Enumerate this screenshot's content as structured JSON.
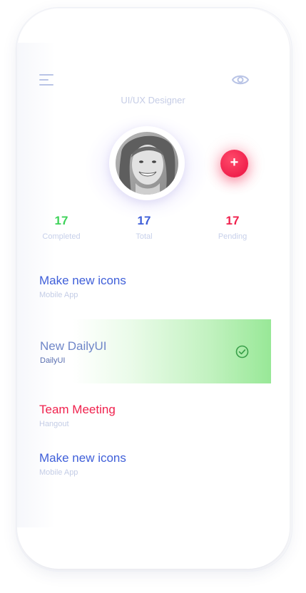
{
  "header": {
    "menu_icon": "menu-icon",
    "eye_icon": "eye-icon",
    "role": "UI/UX Designer"
  },
  "profile": {
    "avatar": "avatar",
    "add_button_label": "+"
  },
  "stats": [
    {
      "value": "17",
      "label": "Completed",
      "color": "#3fd35a"
    },
    {
      "value": "17",
      "label": "Total",
      "color": "#3f5fd9"
    },
    {
      "value": "17",
      "label": "Pending",
      "color": "#f0214d"
    }
  ],
  "tasks": [
    {
      "title": "Make new icons",
      "subtitle": "Mobile App",
      "color": "#3f5fd9"
    },
    {
      "title": "New DailyUI",
      "subtitle": "DailyUI",
      "color": "#6f86c8",
      "status": "completed"
    },
    {
      "title": "Team Meeting",
      "subtitle": "Hangout",
      "color": "#f0214d"
    },
    {
      "title": "Make new icons",
      "subtitle": "Mobile App",
      "color": "#3f5fd9"
    }
  ],
  "colors": {
    "accent_red": "#f0214d",
    "accent_blue": "#3f5fd9",
    "accent_green": "#3fd35a",
    "muted": "#c4cde6"
  }
}
